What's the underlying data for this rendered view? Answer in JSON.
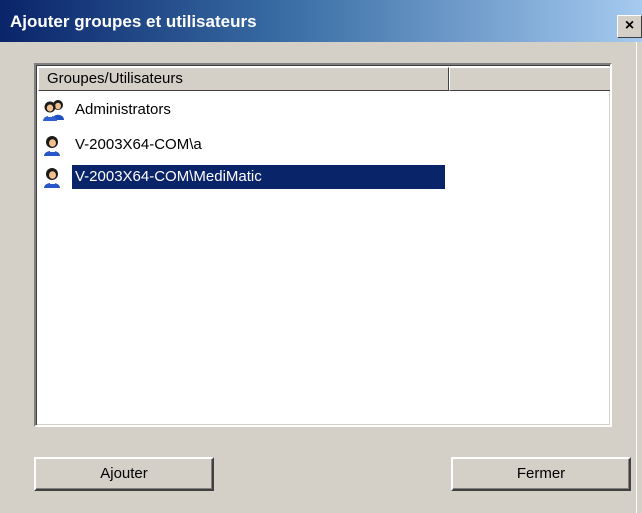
{
  "window": {
    "title": "Ajouter groupes et utilisateurs",
    "close_glyph": "×"
  },
  "list": {
    "columns": [
      "Groupes/Utilisateurs",
      ""
    ],
    "items": [
      {
        "label": "Administrators",
        "icon": "group-icon",
        "selected": false
      },
      {
        "label": "V-2003X64-COM\\a",
        "icon": "user-icon",
        "selected": false
      },
      {
        "label": "V-2003X64-COM\\MediMatic",
        "icon": "user-icon",
        "selected": true
      }
    ]
  },
  "buttons": {
    "add_label": "Ajouter",
    "close_label": "Fermer"
  },
  "colors": {
    "title_gradient_start": "#0a246a",
    "title_gradient_end": "#a6caf0",
    "selection": "#0a246a",
    "face": "#d4d0c8"
  }
}
